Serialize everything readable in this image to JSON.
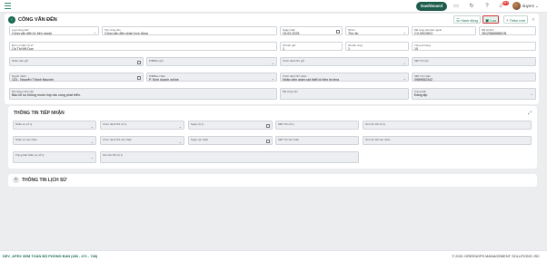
{
  "topbar": {
    "dashboard_label": "Dashboard",
    "notif_count": "99+",
    "username": "duynm"
  },
  "header": {
    "title": "CÔNG VĂN ĐẾN",
    "buttons": {
      "hanh_dong": "Hành động",
      "luu": "Lưu",
      "them_moi": "Thêm mới"
    }
  },
  "form": {
    "loai_cong_van": {
      "label": "Loại công văn",
      "value": "Công văn đến từ bên ngoài"
    },
    "ten_cong_van": {
      "label": "Tên công văn",
      "value": "Công văn đến phản hợp đồng"
    },
    "ngay_nhan": {
      "label": "Ngày nhận",
      "value": "19-02-2025"
    },
    "nhom": {
      "label": "Nhóm",
      "value": "Thư tin"
    },
    "ma_cong_van_ben_ngoai": {
      "label": "Mã công văn bên ngoài",
      "value": "CV-09/19KQ"
    },
    "ma_so_don": {
      "label": "Mã số đơn",
      "value": "281258666B6VN"
    },
    "don_vi_nhan_xu_ly": {
      "label": "Đơn vị nhận xử lý",
      "value": "Cà Thị Mỹ Duy"
    },
    "so_ban_goc": {
      "label": "Số bản gốc",
      "value": "1"
    },
    "so_ban_copy": {
      "label": "Số bản copy",
      "value": "1"
    },
    "tong_so_trang": {
      "label": "Tổng số trang",
      "value": "10"
    },
    "nhan_vien_gui": {
      "label": "Nhân viên gửi",
      "value": ""
    },
    "pb_ban_gui": {
      "label": "P/B/Ban gửi",
      "value": ""
    },
    "chuc_danh_gui": {
      "label": "Chức danh NV gửi",
      "value": ""
    },
    "sdt_nv_gui": {
      "label": "SĐT NV gửi",
      "value": ""
    },
    "nguoi_nhan": {
      "label": "Người nhận",
      "value": "123 - Nguyễn Thành Nguyên"
    },
    "pb_ban_nhan": {
      "label": "P/B/Ban nhận",
      "value": "P. Kinh doanh online"
    },
    "chuc_danh_nhan": {
      "label": "Chức danh NV nhận",
      "value": "Nhân viên giám sát thiết bị hiện trường"
    },
    "sdt_nv_nhan": {
      "label": "SĐT NV nhận",
      "value": "0989652342"
    },
    "noi_dung": {
      "label": "Nội dung công văn",
      "value": "Báo lỗi sự không muốn hợp tác cùng phát triển."
    },
    "ma_cong_van": {
      "label": "Mã công văn",
      "value": ""
    },
    "trang_thai": {
      "label": "Trạng thái",
      "value": "Đang lập"
    }
  },
  "tiep_nhan": {
    "title": "THÔNG TIN TIẾP NHẬN",
    "row1": {
      "nv_xu_ly": {
        "label": "Nhân sự xử lý",
        "value": ""
      },
      "cd_xu_ly": {
        "label": "Chức danh NS xử lý",
        "value": ""
      },
      "ngay_xu_ly": {
        "label": "Ngày xử lý",
        "value": ""
      },
      "sdt_xu_ly": {
        "label": "SĐT NS xử lý",
        "value": ""
      },
      "ghi_chu_xu_ly": {
        "label": "Ghi chú NS xử lý",
        "value": ""
      }
    },
    "row2": {
      "nv_xac_nhan": {
        "label": "Nhân sự xác nhận",
        "value": ""
      },
      "cd_xac_nhan": {
        "label": "Chức danh NS xác nhận",
        "value": ""
      },
      "ngay_xac_nhan": {
        "label": "Ngày xác nhận",
        "value": ""
      },
      "sdt_xac_nhan": {
        "label": "SĐT NS xác nhận",
        "value": ""
      },
      "ghi_chu_xac_nhan": {
        "label": "Ghi chú NS xác nhận",
        "value": ""
      }
    },
    "row3": {
      "trang_thai_xu_ly": {
        "label": "Trạng thái nhân sự xử lý",
        "value": ""
      },
      "ghi_chu_xu_ly2": {
        "label": "Ghi chú NS xử lý",
        "value": ""
      }
    }
  },
  "lich_su": {
    "title": "THÔNG TIN LỊCH SỬ"
  },
  "footer": {
    "left": "DEV_APEX XEM TOÀN BỘ PHÒNG BAN (283 - 471 - 748)",
    "right": "© 2021 GREENOPS MANAGEMENT SOLUTIONS JSC"
  }
}
